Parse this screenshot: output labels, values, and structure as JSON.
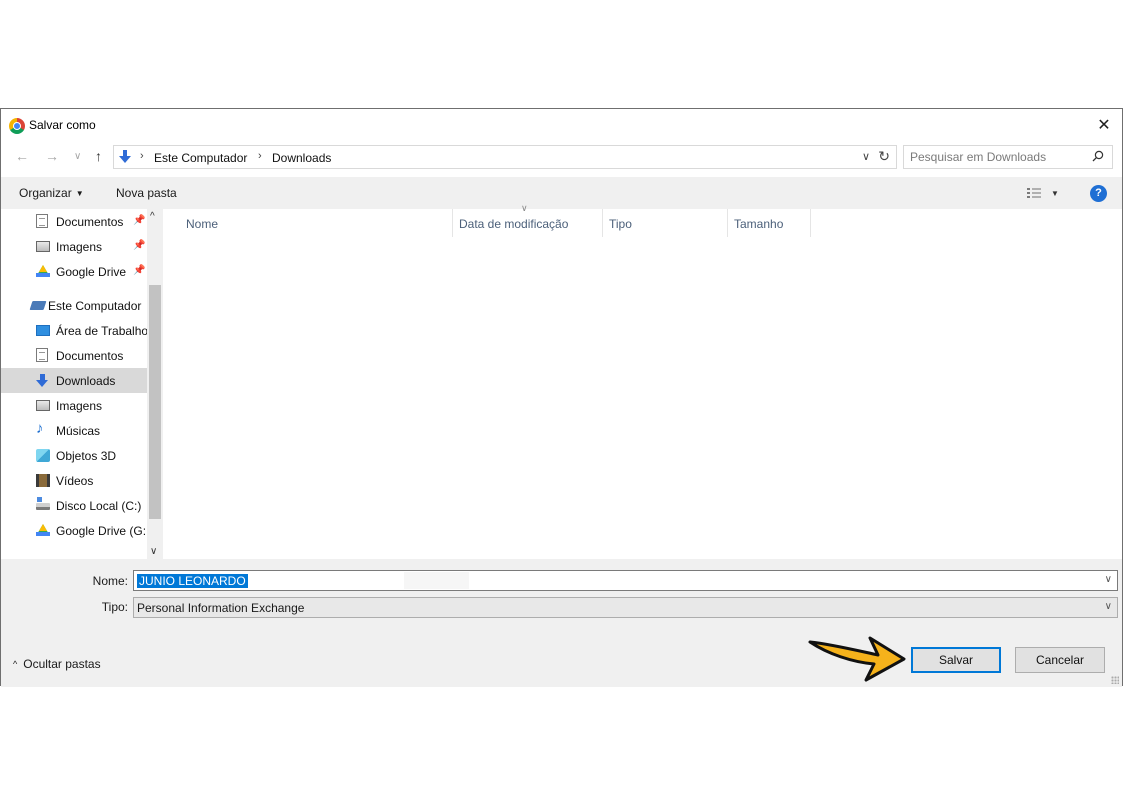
{
  "window": {
    "title": "Salvar como",
    "close_glyph": "✕"
  },
  "nav": {
    "back_glyph": "←",
    "forward_glyph": "→",
    "recent_glyph": "∨",
    "up_glyph": "↑"
  },
  "address": {
    "breadcrumbs": [
      "Este Computador",
      "Downloads"
    ],
    "separator": "›",
    "dropdown_glyph": "∨",
    "refresh_glyph": "↻"
  },
  "search": {
    "placeholder": "Pesquisar em Downloads",
    "value": ""
  },
  "toolbar": {
    "organize_label": "Organizar",
    "organize_caret": "▼",
    "new_folder_label": "Nova pasta",
    "view_caret": "▼",
    "help_label": "?"
  },
  "sidebar": {
    "quick_access": [
      {
        "label": "Documentos",
        "icon": "document-icon",
        "pinned": true
      },
      {
        "label": "Imagens",
        "icon": "pictures-icon",
        "pinned": true
      },
      {
        "label": "Google Drive",
        "icon": "google-drive-icon",
        "pinned": true
      }
    ],
    "computer_label": "Este Computador",
    "computer_items": [
      {
        "label": "Área de Trabalho",
        "icon": "desktop-icon"
      },
      {
        "label": "Documentos",
        "icon": "document-icon"
      },
      {
        "label": "Downloads",
        "icon": "downloads-icon",
        "selected": true
      },
      {
        "label": "Imagens",
        "icon": "pictures-icon"
      },
      {
        "label": "Músicas",
        "icon": "music-icon"
      },
      {
        "label": "Objetos 3D",
        "icon": "3d-objects-icon"
      },
      {
        "label": "Vídeos",
        "icon": "videos-icon"
      },
      {
        "label": "Disco Local (C:)",
        "icon": "local-disk-icon"
      },
      {
        "label": "Google Drive (G:",
        "icon": "google-drive-icon"
      }
    ],
    "pin_glyph": "📌",
    "scroll_up_glyph": "^",
    "scroll_down_glyph": "∨"
  },
  "filelist": {
    "columns": [
      "Nome",
      "Data de modificação",
      "Tipo",
      "Tamanho"
    ],
    "sort_glyph": "∨"
  },
  "form": {
    "name_label": "Nome:",
    "name_value": "JUNIO LEONARDO",
    "type_label": "Tipo:",
    "type_value": "Personal Information Exchange",
    "dropdown_glyph": "∨"
  },
  "footer": {
    "hide_folders_caret": "^",
    "hide_folders_label": "Ocultar pastas",
    "save_label": "Salvar",
    "cancel_label": "Cancelar"
  },
  "colors": {
    "accent": "#0078d7",
    "arrow": "#f5b21b",
    "selection": "#0078d7"
  }
}
